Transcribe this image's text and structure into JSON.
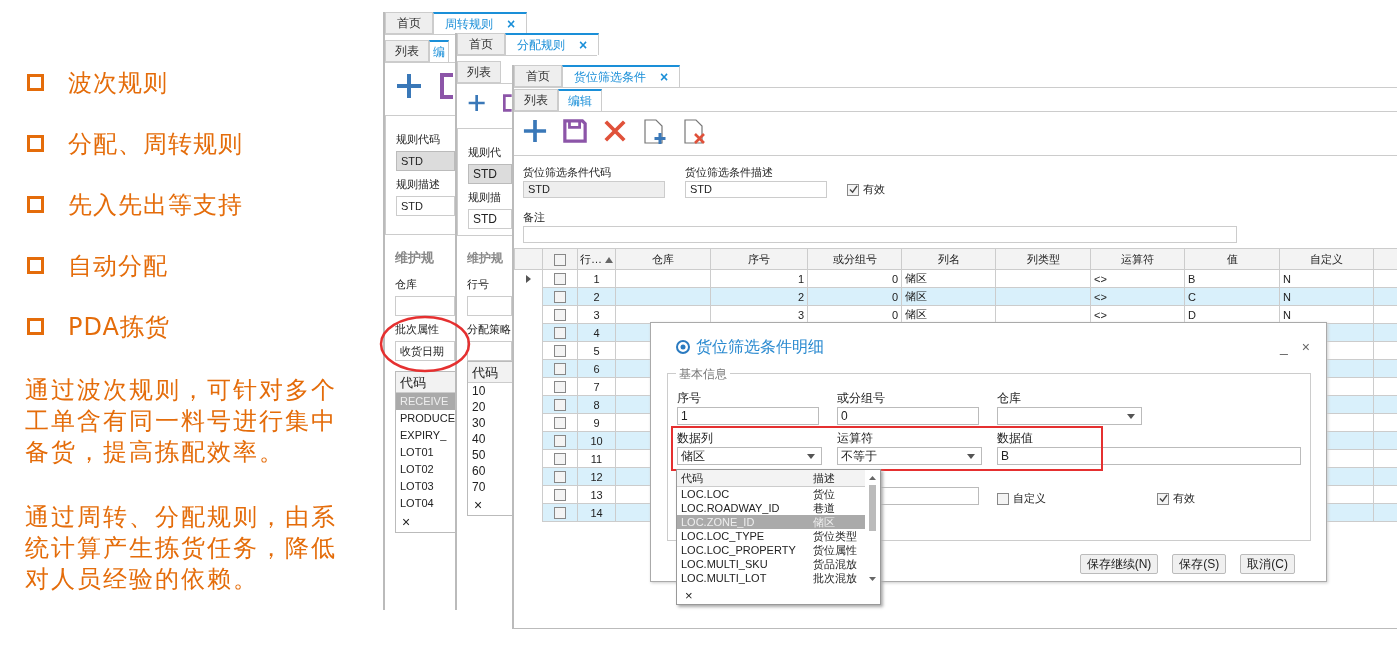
{
  "slide": {
    "bullets": [
      "波次规则",
      "分配、周转规则",
      "先入先出等支持",
      "自动分配",
      "PDA拣货"
    ],
    "paragraphs": [
      "通过波次规则，可针对多个工单含有同一料号进行集中备货，提高拣配效率。",
      "通过周转、分配规则，由系统计算产生拣货任务，降低对人员经验的依赖。"
    ]
  },
  "windows": [
    {
      "tabs": [
        {
          "label": "首页",
          "selected": false
        },
        {
          "label": "周转规则",
          "selected": true,
          "close": "×"
        }
      ],
      "subtabs": [
        {
          "label": "列表",
          "selected": false
        },
        {
          "label": "编",
          "selected": true
        }
      ],
      "fields": [
        {
          "label": "规则代码",
          "value": "STD",
          "readonly": true
        },
        {
          "label": "规则描述",
          "value": "STD",
          "readonly": false
        }
      ],
      "section": "维护规",
      "detail_fields": [
        {
          "label": "仓库",
          "kind": "input"
        },
        {
          "label": "批次属性",
          "kind": "select",
          "value": "收货日期"
        }
      ],
      "list": {
        "header": "代码",
        "items": [
          {
            "label": "RECEIVE",
            "selected": true
          },
          {
            "label": "PRODUCE",
            "selected": false
          },
          {
            "label": "EXPIRY_",
            "selected": false
          },
          {
            "label": "LOT01",
            "selected": false
          },
          {
            "label": "LOT02",
            "selected": false
          },
          {
            "label": "LOT03",
            "selected": false
          },
          {
            "label": "LOT04",
            "selected": false
          }
        ],
        "close": "×"
      }
    },
    {
      "tabs": [
        {
          "label": "首页",
          "selected": false
        },
        {
          "label": "分配规则",
          "selected": true,
          "close": "×"
        }
      ],
      "subtabs": [
        {
          "label": "列表",
          "selected": false
        }
      ],
      "fields": [
        {
          "label": "规则代",
          "value": "STD",
          "readonly": true
        },
        {
          "label": "规则描",
          "value": "STD",
          "readonly": false
        }
      ],
      "section": "维护规",
      "detail_fields": [
        {
          "label": "行号",
          "kind": "input"
        },
        {
          "label": "分配策略",
          "kind": "input"
        }
      ],
      "list": {
        "header": "代码",
        "items": [
          {
            "label": "10",
            "selected": false
          },
          {
            "label": "20",
            "selected": false
          },
          {
            "label": "30",
            "selected": false
          },
          {
            "label": "40",
            "selected": false
          },
          {
            "label": "50",
            "selected": false
          },
          {
            "label": "60",
            "selected": false
          },
          {
            "label": "70",
            "selected": false
          }
        ],
        "close": "×"
      }
    },
    {
      "tabs": [
        {
          "label": "首页",
          "selected": false
        },
        {
          "label": "货位筛选条件",
          "selected": true,
          "close": "×"
        }
      ],
      "subtabs": [
        {
          "label": "列表",
          "selected": false
        },
        {
          "label": "编辑",
          "selected": true
        }
      ],
      "form": {
        "code_label": "货位筛选条件代码",
        "code_value": "STD",
        "desc_label": "货位筛选条件描述",
        "desc_value": "STD",
        "valid_label": "有效",
        "valid_checked": true,
        "remark_label": "备注"
      },
      "grid": {
        "header_checked": false,
        "columns": [
          {
            "label": "行…",
            "sorted": true
          },
          {
            "label": "仓库",
            "sorted": false
          },
          {
            "label": "序号",
            "sorted": false
          },
          {
            "label": "或分组号",
            "sorted": false
          },
          {
            "label": "列名",
            "sorted": false
          },
          {
            "label": "列类型",
            "sorted": false
          },
          {
            "label": "运算符",
            "sorted": false
          },
          {
            "label": "值",
            "sorted": false
          },
          {
            "label": "自定义",
            "sorted": false
          }
        ],
        "rows": [
          {
            "current": true,
            "checked": false,
            "cells": [
              "1",
              "",
              "1",
              "0",
              "储区",
              "",
              "<>",
              "B",
              "N"
            ]
          },
          {
            "current": false,
            "checked": false,
            "cells": [
              "2",
              "",
              "2",
              "0",
              "储区",
              "",
              "<>",
              "C",
              "N"
            ]
          },
          {
            "current": false,
            "checked": false,
            "cells": [
              "3",
              "",
              "3",
              "0",
              "储区",
              "",
              "<>",
              "D",
              "N"
            ]
          },
          {
            "current": false,
            "checked": false,
            "cells": [
              "4"
            ]
          },
          {
            "current": false,
            "checked": false,
            "cells": [
              "5"
            ]
          },
          {
            "current": false,
            "checked": false,
            "cells": [
              "6"
            ]
          },
          {
            "current": false,
            "checked": false,
            "cells": [
              "7"
            ]
          },
          {
            "current": false,
            "checked": false,
            "cells": [
              "8"
            ]
          },
          {
            "current": false,
            "checked": false,
            "cells": [
              "9"
            ]
          },
          {
            "current": false,
            "checked": false,
            "cells": [
              "10"
            ]
          },
          {
            "current": false,
            "checked": false,
            "cells": [
              "11"
            ]
          },
          {
            "current": false,
            "checked": false,
            "cells": [
              "12"
            ]
          },
          {
            "current": false,
            "checked": false,
            "cells": [
              "13"
            ]
          },
          {
            "current": false,
            "checked": false,
            "cells": [
              "14"
            ]
          }
        ]
      }
    }
  ],
  "dialog": {
    "title": "货位筛选条件明细",
    "minimize": "_",
    "close": "×",
    "section": "基本信息",
    "fields": [
      {
        "kind": "input",
        "label": "序号",
        "value": "1"
      },
      {
        "kind": "input",
        "label": "或分组号",
        "value": "0"
      },
      {
        "kind": "select",
        "label": "仓库"
      },
      {
        "kind": "select",
        "label": "数据列",
        "value": "储区"
      },
      {
        "kind": "select",
        "label": "运算符",
        "value": "不等于"
      },
      {
        "kind": "input",
        "label": "数据值",
        "value": "B"
      },
      {
        "kind": "input"
      },
      {
        "kind": "checkbox",
        "label": "自定义",
        "checked": false
      },
      {
        "kind": "checkbox",
        "label": "有效",
        "checked": true
      }
    ],
    "buttons": [
      "保存继续(N)",
      "保存(S)",
      "取消(C)"
    ],
    "dropdown": {
      "columns": [
        "代码",
        "描述"
      ],
      "rows": [
        {
          "code": "LOC.LOC",
          "desc": "货位",
          "selected": false
        },
        {
          "code": "LOC.ROADWAY_ID",
          "desc": "巷道",
          "selected": false
        },
        {
          "code": "LOC.ZONE_ID",
          "desc": "储区",
          "selected": true
        },
        {
          "code": "LOC.LOC_TYPE",
          "desc": "货位类型",
          "selected": false
        },
        {
          "code": "LOC.LOC_PROPERTY",
          "desc": "货位属性",
          "selected": false
        },
        {
          "code": "LOC.MULTI_SKU",
          "desc": "货品混放",
          "selected": false
        },
        {
          "code": "LOC.MULTI_LOT",
          "desc": "批次混放",
          "selected": false
        }
      ],
      "close": "×"
    }
  }
}
